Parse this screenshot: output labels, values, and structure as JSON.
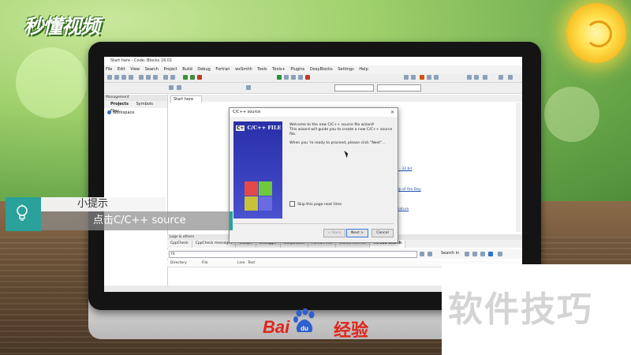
{
  "brand": {
    "top_logo": "秒懂视频",
    "baidu_bai": "Bai",
    "baidu_du": "du",
    "baidu_jingyan": "经验",
    "corner_text": "软件技巧"
  },
  "ide": {
    "title": "Start here - Code::Blocks 16.01",
    "menu": [
      "File",
      "Edit",
      "View",
      "Search",
      "Project",
      "Build",
      "Debug",
      "Fortran",
      "wxSmith",
      "Tools",
      "Tools+",
      "Plugins",
      "DoxyBlocks",
      "Settings",
      "Help"
    ],
    "management_title": "Management",
    "management_tabs": [
      "Projects",
      "Symbols",
      "Files"
    ],
    "workspace": "Workspace",
    "editor_tab": "Start here",
    "editor_heading_fragment": "s",
    "editor_links": [
      "n - 32 bit",
      "Tip of the Day",
      "feature"
    ],
    "logs_title": "Logs & others",
    "log_tabs": [
      "CppCheck",
      "CppCheck messages",
      "Cscope",
      "Debugger",
      "DoxyBlocks",
      "Fortran info",
      "Closed files list",
      "Thread search"
    ],
    "search_value": "fit",
    "search_in_label": "Search in",
    "result_columns": [
      "Directory",
      "File",
      "Line",
      "Text"
    ]
  },
  "dialog": {
    "title": "C/C++ source",
    "close": "✕",
    "banner_badge": "C+",
    "banner_text": "C/C++ FILE",
    "line1": "Welcome to the new C/C++ source file wizard!",
    "line2": "This wizard will guide you to create a new C/C++ source file.",
    "line3": "When you 're ready to proceed, please click \"Next\"...",
    "checkbox_label": "Skip this page next time",
    "back_label": "< Back",
    "next_label": "Next >",
    "cancel_label": "Cancel"
  },
  "tip": {
    "title": "小提示",
    "body": "点击C/C++ source"
  },
  "colors": {
    "accent_teal": "#2aa19a",
    "baidu_red": "#e1251b",
    "wizard_blue": "#2a2fa8"
  }
}
